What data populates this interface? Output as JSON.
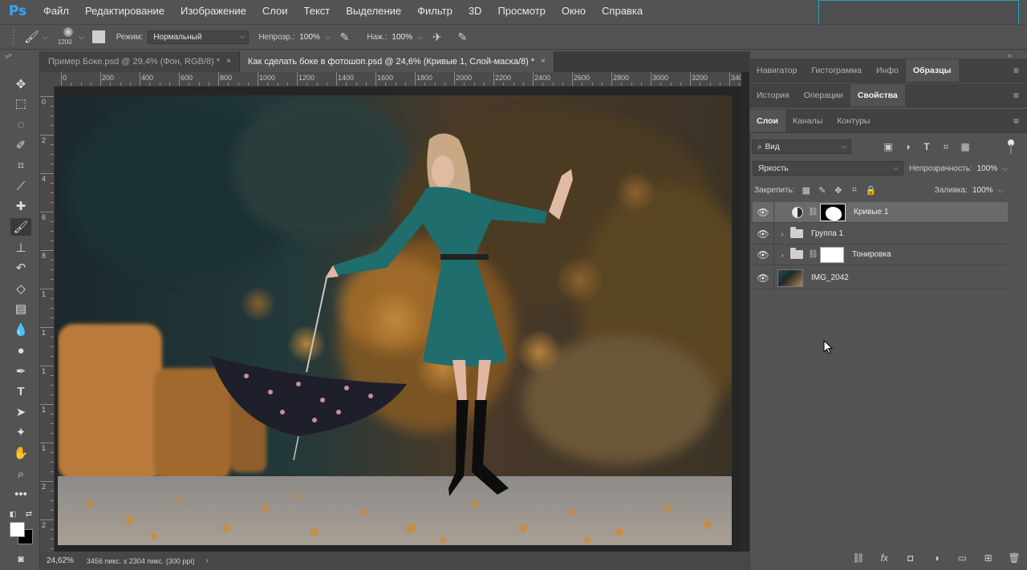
{
  "app": {
    "logo": "Ps",
    "accent": "#31a8ff"
  },
  "menu": [
    "Файл",
    "Редактирование",
    "Изображение",
    "Слои",
    "Текст",
    "Выделение",
    "Фильтр",
    "3D",
    "Просмотр",
    "Окно",
    "Справка"
  ],
  "options": {
    "brush_size": "1200",
    "mode_label": "Режим:",
    "mode_value": "Нормальный",
    "opacity_label": "Непрозр.:",
    "opacity_value": "100%",
    "flow_label": "Наж.:",
    "flow_value": "100%"
  },
  "tabs": [
    {
      "title": "Пример Боке.psd @ 29,4% (Фон, RGB/8) *",
      "close": "×",
      "active": false
    },
    {
      "title": "Как сделать боке в фотошоп.psd @ 24,6% (Кривые 1, Слой-маска/8) *",
      "close": "×",
      "active": true
    }
  ],
  "ruler": {
    "h_labels": [
      "0",
      "200",
      "400",
      "600",
      "800",
      "1000",
      "1200",
      "1400",
      "1600",
      "1800",
      "2000",
      "2200",
      "2400",
      "2600",
      "2800",
      "3000",
      "3200",
      "340"
    ],
    "v_labels": [
      "0",
      "2",
      "4",
      "6",
      "8",
      "1",
      "1",
      "1",
      "1",
      "1",
      "2",
      "2"
    ]
  },
  "status": {
    "zoom": "24,62%",
    "doc_info": "3456 пикс. x 2304 пикс. (300 ppi)",
    "arrow": "›"
  },
  "panels": {
    "row1": [
      "Навигатор",
      "Гистограмма",
      "Инфо",
      "Образцы"
    ],
    "row1_active": "Образцы",
    "row2": [
      "История",
      "Операции",
      "Свойства"
    ],
    "row2_active": "Свойства",
    "row3": [
      "Слои",
      "Каналы",
      "Контуры"
    ],
    "row3_active": "Слои",
    "menu_icon": "≡"
  },
  "layers_panel": {
    "filter_value": "Вид",
    "blend_mode": "Яркость",
    "opacity_label": "Непрозрачность:",
    "opacity_value": "100%",
    "lock_label": "Закрепить:",
    "fill_label": "Заливка:",
    "fill_value": "100%",
    "layers": [
      {
        "name": "Кривые 1",
        "type": "adjustment",
        "selected": true
      },
      {
        "name": "Группа 1",
        "type": "group",
        "selected": false
      },
      {
        "name": "Тонировка",
        "type": "group-mask",
        "selected": false
      },
      {
        "name": "IMG_2042",
        "type": "image",
        "selected": false
      }
    ]
  },
  "colors": {
    "foreground": "#ffffff",
    "background": "#000000",
    "panel_bg": "#535353",
    "canvas_bg": "#282828",
    "selection_border": "#1aa7b2"
  }
}
